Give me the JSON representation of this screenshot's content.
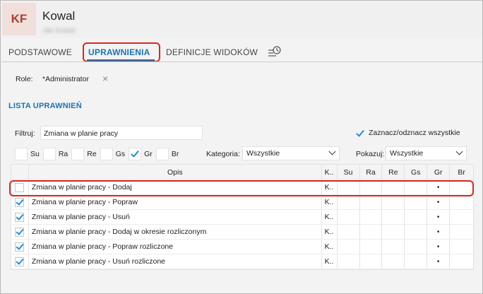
{
  "header": {
    "avatar_initials": "KF",
    "title": "Kowal",
    "subtitle": "Jan Kowal"
  },
  "tabs": [
    {
      "label": "PODSTAWOWE",
      "active": false
    },
    {
      "label": "UPRAWNIENIA",
      "active": true
    },
    {
      "label": "DEFINICJE WIDOKÓW",
      "active": false
    }
  ],
  "role": {
    "label": "Role:",
    "value": "*Administrator",
    "remove_glyph": "×"
  },
  "section_title": "LISTA UPRAWNIEŃ",
  "filter": {
    "label": "Filtruj:",
    "value": "Zmiana w planie pracy"
  },
  "select_all": {
    "label": "Zaznacz/odznacz wszystkie",
    "checked": true
  },
  "permission_filters": [
    {
      "label": "Su",
      "checked": false
    },
    {
      "label": "Ra",
      "checked": false
    },
    {
      "label": "Re",
      "checked": false
    },
    {
      "label": "Gs",
      "checked": false
    },
    {
      "label": "Gr",
      "checked": true
    },
    {
      "label": "Br",
      "checked": false
    }
  ],
  "category": {
    "label": "Kategoria:",
    "value": "Wszystkie"
  },
  "show": {
    "label": "Pokazuj:",
    "value": "Wszystkie"
  },
  "table": {
    "columns": [
      "",
      "Opis",
      "K..",
      "Su",
      "Ra",
      "Re",
      "Gs",
      "Gr",
      "Br"
    ],
    "rows": [
      {
        "checked": false,
        "opis": "Zmiana w planie pracy - Dodaj",
        "k": "K..",
        "su": "",
        "ra": "",
        "re": "",
        "gs": "",
        "gr": "•",
        "br": ""
      },
      {
        "checked": true,
        "opis": "Zmiana w planie pracy - Popraw",
        "k": "K..",
        "su": "",
        "ra": "",
        "re": "",
        "gs": "",
        "gr": "•",
        "br": ""
      },
      {
        "checked": true,
        "opis": "Zmiana w planie pracy - Usuń",
        "k": "K..",
        "su": "",
        "ra": "",
        "re": "",
        "gs": "",
        "gr": "•",
        "br": ""
      },
      {
        "checked": true,
        "opis": "Zmiana w planie pracy - Dodaj w okresie rozliczonym",
        "k": "K..",
        "su": "",
        "ra": "",
        "re": "",
        "gs": "",
        "gr": "•",
        "br": ""
      },
      {
        "checked": true,
        "opis": "Zmiana w planie pracy - Popraw rozliczone",
        "k": "K..",
        "su": "",
        "ra": "",
        "re": "",
        "gs": "",
        "gr": "•",
        "br": ""
      },
      {
        "checked": true,
        "opis": "Zmiana w planie pracy - Usuń rozliczone",
        "k": "K..",
        "su": "",
        "ra": "",
        "re": "",
        "gs": "",
        "gr": "•",
        "br": ""
      }
    ]
  },
  "colors": {
    "accent": "#1a73b8",
    "highlight": "#d9281f",
    "check": "#1a8fdc",
    "avatar_bg": "#f1dfdc",
    "avatar_fg": "#b13c2e"
  },
  "icons": {
    "history": "history-icon"
  }
}
